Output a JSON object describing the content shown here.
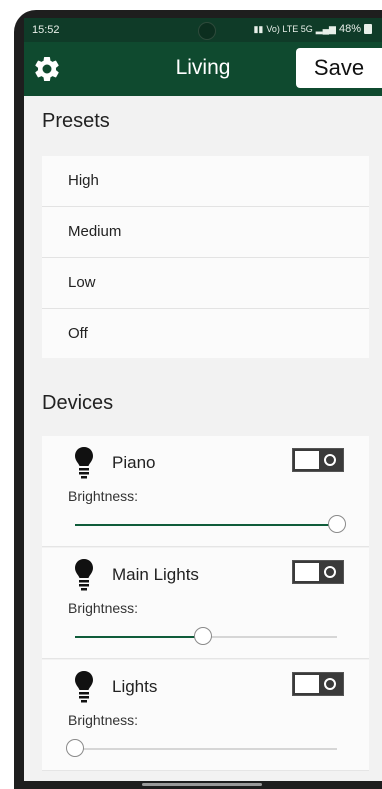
{
  "status_bar": {
    "time": "15:52",
    "network": "Vo) LTE 5G",
    "battery": "48%"
  },
  "header": {
    "title": "Living",
    "save_label": "Save",
    "settings_icon": "gear-icon"
  },
  "presets": {
    "title": "Presets",
    "items": [
      {
        "label": "High"
      },
      {
        "label": "Medium"
      },
      {
        "label": "Low"
      },
      {
        "label": "Off"
      }
    ]
  },
  "devices": {
    "title": "Devices",
    "brightness_label": "Brightness:",
    "items": [
      {
        "name": "Piano",
        "on": false,
        "brightness": 1.0
      },
      {
        "name": "Main Lights",
        "on": false,
        "brightness": 0.49
      },
      {
        "name": "Lights",
        "on": false,
        "brightness": 0.0
      }
    ]
  },
  "colors": {
    "accent": "#0f4a2f",
    "slider_fill": "#0f5c3a",
    "background": "#f2f2f2"
  }
}
